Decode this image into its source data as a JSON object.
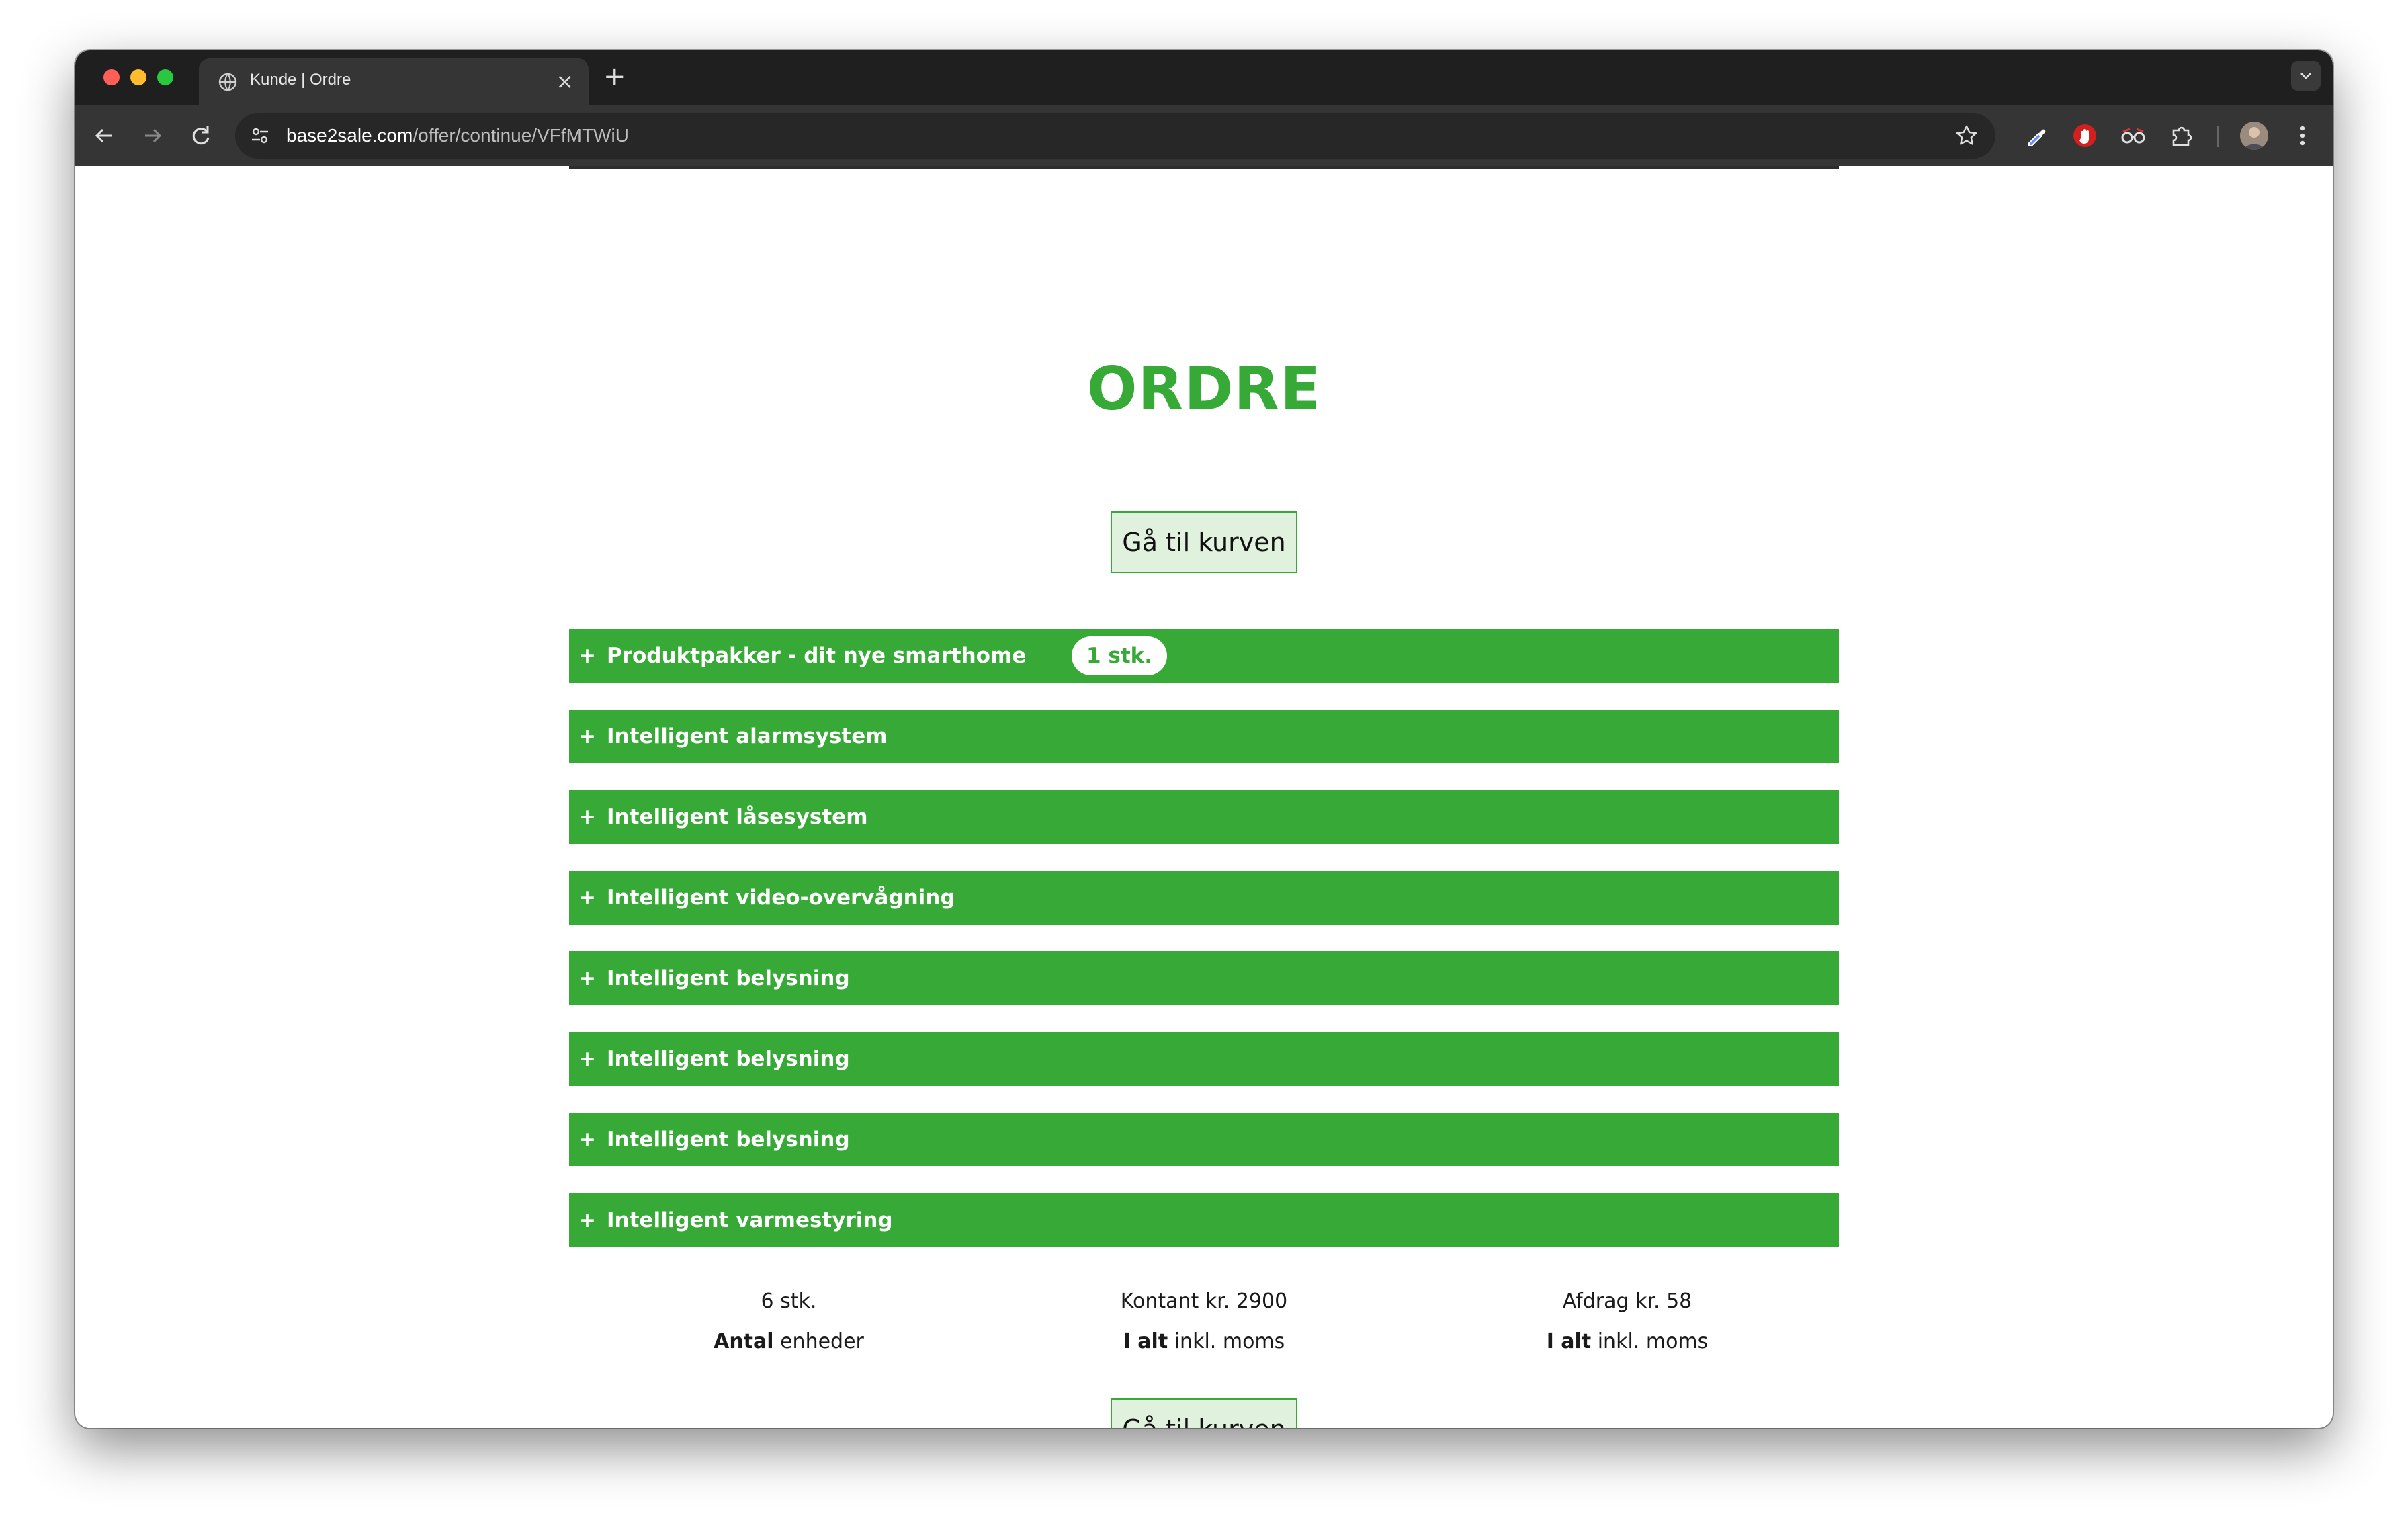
{
  "browser": {
    "tab_title": "Kunde | Ordre",
    "tab_close": "×",
    "new_tab": "+",
    "url_host": "base2sale.com",
    "url_path": "/offer/continue/VFfMTWiU",
    "icons": [
      "globe-icon",
      "back-icon",
      "forward-icon",
      "reload-icon",
      "site-settings-icon",
      "bookmark-star-icon",
      "eyedropper-icon",
      "hand-stop-icon",
      "glasses-icon",
      "puzzle-icon",
      "avatar",
      "more-icon"
    ]
  },
  "page": {
    "title": "ORDRE",
    "cart_button_label": "Gå til kurven",
    "accent_color": "#36a936"
  },
  "accordion": [
    {
      "label": "Produktpakker - dit nye smarthome",
      "badge": "1 stk."
    },
    {
      "label": "Intelligent alarmsystem"
    },
    {
      "label": "Intelligent låsesystem"
    },
    {
      "label": "Intelligent video-overvågning"
    },
    {
      "label": "Intelligent belysning"
    },
    {
      "label": "Intelligent belysning"
    },
    {
      "label": "Intelligent belysning"
    },
    {
      "label": "Intelligent varmestyring"
    }
  ],
  "accordion_plus": "+",
  "summary": {
    "units": {
      "value": "6 stk.",
      "caption_bold": "Antal",
      "caption_rest": " enheder"
    },
    "cash": {
      "value": "Kontant kr. 2900",
      "caption_bold": "I alt",
      "caption_rest": " inkl. moms"
    },
    "installment": {
      "value": "Afdrag kr. 58",
      "caption_bold": "I alt",
      "caption_rest": " inkl. moms"
    }
  }
}
